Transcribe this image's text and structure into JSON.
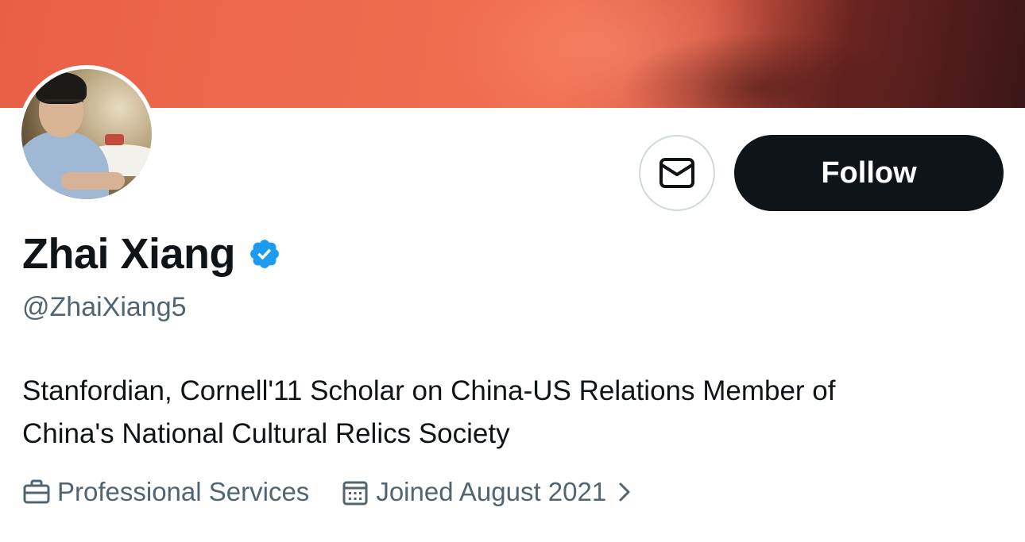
{
  "profile": {
    "display_name": "Zhai Xiang",
    "handle": "@ZhaiXiang5",
    "bio_line1": "Stanfordian, Cornell'11 Scholar on China-US Relations Member of",
    "bio_line2": "China's National Cultural Relics Society",
    "verified": true
  },
  "actions": {
    "follow_label": "Follow",
    "message_icon": "envelope-icon"
  },
  "meta": {
    "category": "Professional Services",
    "category_icon": "briefcase-icon",
    "joined": "Joined August 2021",
    "joined_icon": "calendar-icon"
  },
  "colors": {
    "banner_primary": "#ee6a4e",
    "text_primary": "#0f1419",
    "text_secondary": "#536471",
    "verified_blue": "#1d9bf0",
    "follow_bg": "#0f1419"
  }
}
